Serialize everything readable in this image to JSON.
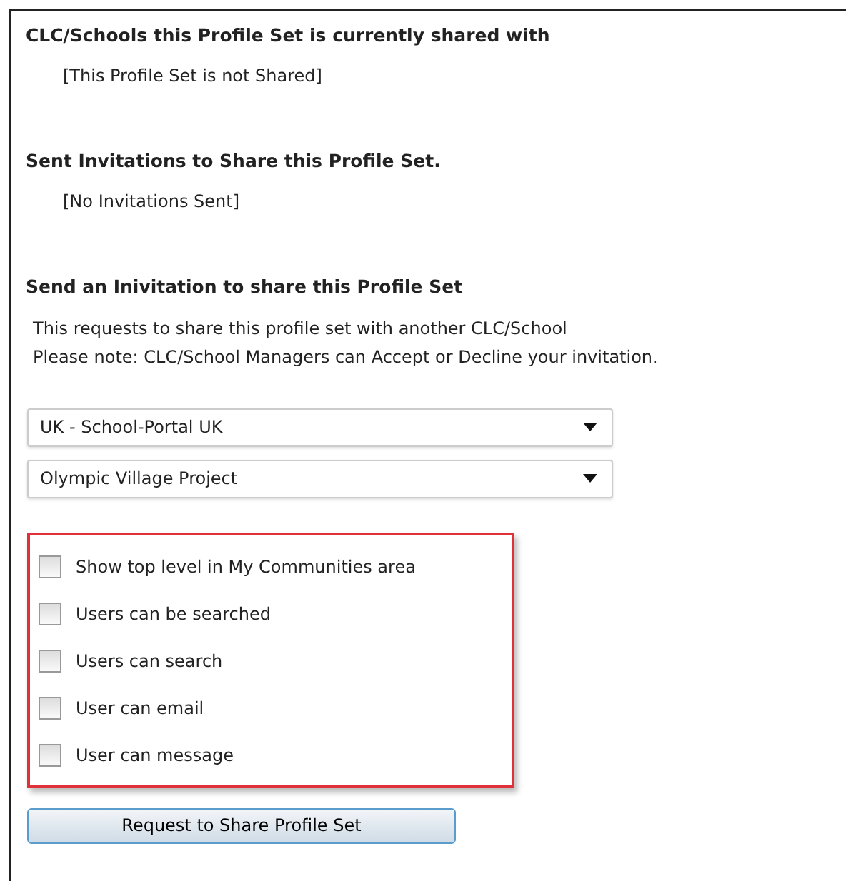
{
  "sections": [
    {
      "heading": "CLC/Schools this Profile Set is currently shared with",
      "note": "[This Profile Set is not Shared]"
    },
    {
      "heading": "Sent Invitations to Share this Profile Set.",
      "note": "[No Invitations Sent]"
    },
    {
      "heading": "Send an Inivitation to share this Profile Set",
      "description": [
        "This requests to share this profile set with another CLC/School",
        "Please note: CLC/School Managers can Accept or Decline your invitation."
      ]
    }
  ],
  "dropdowns": [
    {
      "value": "UK - School-Portal UK"
    },
    {
      "value": "Olympic Village Project"
    }
  ],
  "options": [
    {
      "label": "Show top level in My Communities area",
      "checked": false
    },
    {
      "label": "Users can be searched",
      "checked": false
    },
    {
      "label": "Users can search",
      "checked": false
    },
    {
      "label": "User can email",
      "checked": false
    },
    {
      "label": "User can message",
      "checked": false
    }
  ],
  "submit_button": "Request to Share Profile Set"
}
